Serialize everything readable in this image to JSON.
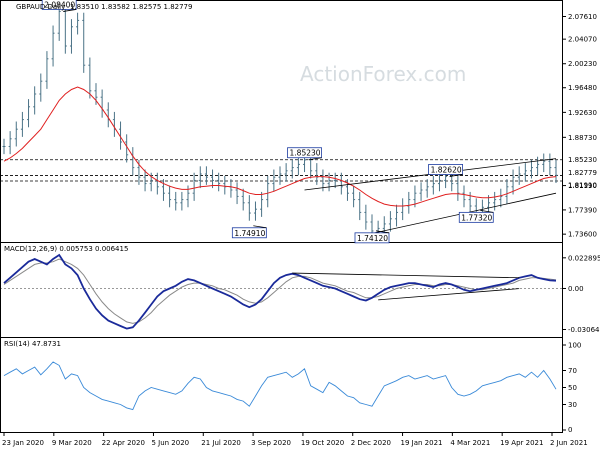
{
  "chart_data": {
    "type": "line",
    "title": "GBPAUD Daily",
    "watermark": "ActionForex.com",
    "header_ohlc": "1.83510 1.83582 1.82575 1.82779",
    "x_ticks": [
      "23 Jan 2020",
      "9 Mar 2020",
      "22 Apr 2020",
      "5 Jun 2020",
      "21 Jul 2020",
      "3 Sep 2020",
      "19 Oct 2020",
      "2 Dec 2020",
      "19 Jan 2021",
      "4 Mar 2021",
      "19 Apr 2021",
      "2 Jun 2021"
    ],
    "price_axis": {
      "ylim": [
        1.73,
        2.08
      ],
      "ticks": [
        "2.07610",
        "2.04070",
        "2.00230",
        "1.96480",
        "1.92630",
        "1.88730",
        "1.81190",
        "1.77390",
        "1.73600"
      ],
      "tagged_levels": [
        "1.85230",
        "1.82779",
        "1.81910"
      ]
    },
    "levels": [
      {
        "name": "high-level",
        "value": 1.8523
      },
      {
        "name": "current-level",
        "value": 1.82779
      },
      {
        "name": "support-level",
        "value": 1.8191
      }
    ],
    "price_series": {
      "values": [
        1.873,
        1.885,
        1.9,
        1.915,
        1.935,
        1.955,
        1.975,
        2.01,
        2.05,
        2.084,
        2.03,
        2.06,
        2.07,
        2.0,
        1.96,
        1.95,
        1.93,
        1.915,
        1.9,
        1.88,
        1.86,
        1.84,
        1.825,
        1.815,
        1.82,
        1.81,
        1.8,
        1.79,
        1.785,
        1.79,
        1.8,
        1.82,
        1.83,
        1.825,
        1.82,
        1.815,
        1.81,
        1.805,
        1.795,
        1.785,
        1.769,
        1.775,
        1.79,
        1.815,
        1.825,
        1.83,
        1.835,
        1.84,
        1.845,
        1.852,
        1.835,
        1.825,
        1.815,
        1.82,
        1.82,
        1.81,
        1.8,
        1.79,
        1.77,
        1.755,
        1.741,
        1.745,
        1.752,
        1.76,
        1.77,
        1.78,
        1.79,
        1.8,
        1.805,
        1.81,
        1.815,
        1.82,
        1.826,
        1.815,
        1.8,
        1.79,
        1.78,
        1.773,
        1.778,
        1.785,
        1.79,
        1.795,
        1.81,
        1.825,
        1.83,
        1.835,
        1.84,
        1.845,
        1.85,
        1.84,
        1.828
      ]
    },
    "ma_series": {
      "values": [
        1.85,
        1.855,
        1.862,
        1.87,
        1.88,
        1.89,
        1.9,
        1.915,
        1.93,
        1.945,
        1.955,
        1.962,
        1.966,
        1.962,
        1.955,
        1.945,
        1.932,
        1.918,
        1.903,
        1.888,
        1.873,
        1.858,
        1.845,
        1.834,
        1.826,
        1.82,
        1.815,
        1.811,
        1.808,
        1.806,
        1.806,
        1.808,
        1.81,
        1.811,
        1.812,
        1.812,
        1.811,
        1.81,
        1.808,
        1.804,
        1.8,
        1.798,
        1.798,
        1.8,
        1.803,
        1.807,
        1.811,
        1.815,
        1.819,
        1.823,
        1.825,
        1.826,
        1.826,
        1.825,
        1.823,
        1.82,
        1.816,
        1.811,
        1.805,
        1.798,
        1.792,
        1.787,
        1.783,
        1.781,
        1.78,
        1.78,
        1.781,
        1.783,
        1.786,
        1.789,
        1.792,
        1.795,
        1.798,
        1.799,
        1.799,
        1.798,
        1.796,
        1.794,
        1.793,
        1.793,
        1.794,
        1.796,
        1.799,
        1.803,
        1.807,
        1.811,
        1.815,
        1.819,
        1.823,
        1.825,
        1.826
      ]
    },
    "callouts": [
      {
        "label": "2.08400",
        "value": 2.084,
        "index": 9
      },
      {
        "label": "1.74910",
        "value": 1.7491,
        "index": 40
      },
      {
        "label": "1.85230",
        "value": 1.8523,
        "index": 49
      },
      {
        "label": "1.74120",
        "value": 1.7412,
        "index": 60
      },
      {
        "label": "1.82620",
        "value": 1.8262,
        "index": 72
      },
      {
        "label": "1.77320",
        "value": 1.7732,
        "index": 77
      }
    ],
    "channel": [
      {
        "name": "channel-upper",
        "from": [
          49,
          1.805
        ],
        "to": [
          90,
          1.854
        ]
      },
      {
        "name": "channel-lower",
        "from": [
          59,
          1.735
        ],
        "to": [
          90,
          1.8
        ]
      }
    ],
    "macd": {
      "title": "MACD(12,26,9) 0.005753 0.006415",
      "ylim": [
        -0.034,
        0.025
      ],
      "ticks": [
        "0.022895",
        "0.00",
        "-0.030645"
      ],
      "macd_values": [
        0.004,
        0.008,
        0.012,
        0.016,
        0.02,
        0.022,
        0.02,
        0.018,
        0.022,
        0.025,
        0.018,
        0.015,
        0.01,
        0.0,
        -0.008,
        -0.015,
        -0.02,
        -0.024,
        -0.026,
        -0.028,
        -0.03,
        -0.029,
        -0.024,
        -0.018,
        -0.012,
        -0.006,
        -0.002,
        0.0,
        0.002,
        0.005,
        0.007,
        0.006,
        0.004,
        0.002,
        0.0,
        -0.002,
        -0.004,
        -0.006,
        -0.009,
        -0.012,
        -0.014,
        -0.012,
        -0.008,
        -0.002,
        0.004,
        0.008,
        0.01,
        0.011,
        0.01,
        0.008,
        0.006,
        0.004,
        0.002,
        0.001,
        0.0,
        -0.002,
        -0.004,
        -0.006,
        -0.008,
        -0.009,
        -0.007,
        -0.004,
        -0.001,
        0.001,
        0.002,
        0.003,
        0.004,
        0.004,
        0.003,
        0.002,
        0.001,
        0.003,
        0.004,
        0.003,
        0.001,
        -0.001,
        -0.002,
        -0.001,
        0.0,
        0.001,
        0.002,
        0.003,
        0.004,
        0.006,
        0.008,
        0.009,
        0.01,
        0.008,
        0.007,
        0.006,
        0.0058
      ],
      "signal_values": [
        0.003,
        0.006,
        0.009,
        0.012,
        0.015,
        0.018,
        0.019,
        0.019,
        0.02,
        0.022,
        0.02,
        0.018,
        0.015,
        0.01,
        0.003,
        -0.004,
        -0.01,
        -0.015,
        -0.019,
        -0.022,
        -0.025,
        -0.026,
        -0.025,
        -0.022,
        -0.018,
        -0.013,
        -0.009,
        -0.005,
        -0.002,
        0.001,
        0.003,
        0.004,
        0.004,
        0.003,
        0.002,
        0.0,
        -0.001,
        -0.003,
        -0.005,
        -0.008,
        -0.01,
        -0.011,
        -0.01,
        -0.007,
        -0.003,
        0.001,
        0.005,
        0.008,
        0.009,
        0.009,
        0.008,
        0.006,
        0.004,
        0.003,
        0.002,
        0.0,
        -0.002,
        -0.003,
        -0.005,
        -0.007,
        -0.007,
        -0.006,
        -0.004,
        -0.002,
        0.0,
        0.001,
        0.002,
        0.003,
        0.003,
        0.003,
        0.002,
        0.002,
        0.003,
        0.003,
        0.002,
        0.001,
        0.0,
        -0.001,
        -0.001,
        0.0,
        0.001,
        0.002,
        0.003,
        0.004,
        0.006,
        0.007,
        0.008,
        0.008,
        0.0075,
        0.007,
        0.0064
      ],
      "trendlines": [
        {
          "name": "macd-upper-trendline",
          "from": [
            47,
            0.0115
          ],
          "to": [
            84,
            0.008
          ]
        },
        {
          "name": "macd-lower-trendline",
          "from": [
            61,
            -0.0085
          ],
          "to": [
            84,
            -0.0001
          ]
        }
      ]
    },
    "rsi": {
      "title": "RSI(14) 47.8731",
      "ylim": [
        0,
        100
      ],
      "ticks": [
        "100",
        "70",
        "50",
        "30",
        "0"
      ],
      "values": [
        64,
        68,
        72,
        66,
        70,
        74,
        65,
        72,
        80,
        76,
        60,
        66,
        64,
        50,
        44,
        40,
        36,
        34,
        32,
        30,
        26,
        24,
        40,
        46,
        50,
        48,
        46,
        44,
        42,
        46,
        55,
        62,
        60,
        50,
        46,
        44,
        42,
        40,
        36,
        34,
        28,
        40,
        52,
        62,
        64,
        66,
        68,
        62,
        66,
        72,
        52,
        48,
        44,
        56,
        52,
        46,
        40,
        38,
        32,
        30,
        28,
        40,
        52,
        55,
        58,
        62,
        64,
        60,
        62,
        64,
        60,
        62,
        64,
        50,
        42,
        40,
        42,
        46,
        52,
        54,
        56,
        58,
        62,
        64,
        66,
        62,
        68,
        62,
        70,
        60,
        48
      ]
    }
  }
}
